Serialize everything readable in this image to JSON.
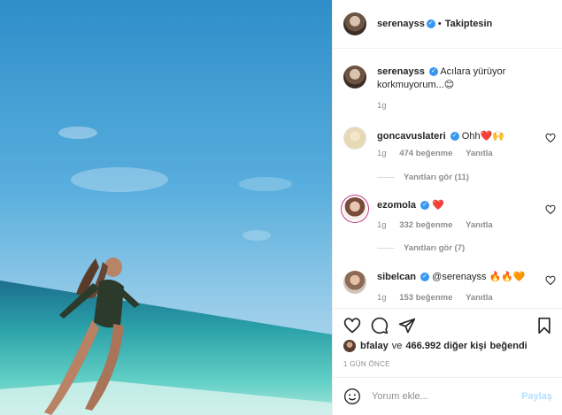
{
  "header": {
    "username": "serenayss",
    "separator": "•",
    "follow_label": "Takiptesin"
  },
  "caption": {
    "username": "serenayss",
    "text": "Acılara yürüyor korkmuyorum...😊",
    "time": "1g"
  },
  "comments": [
    {
      "username": "goncavuslateri",
      "text": "Ohh❤️🙌",
      "time": "1g",
      "likes": "474 beğenme",
      "reply_label": "Yanıtla",
      "view_replies": "Yanıtları gör (11)"
    },
    {
      "username": "ezomola",
      "text": "❤️",
      "time": "1g",
      "likes": "332 beğenme",
      "reply_label": "Yanıtla",
      "view_replies": "Yanıtları gör (7)"
    },
    {
      "username": "sibelcan",
      "text": "@serenayss 🔥🔥🧡",
      "time": "1g",
      "likes": "153 beğenme",
      "reply_label": "Yanıtla"
    }
  ],
  "likes": {
    "user": "bfalay",
    "connector": "ve",
    "count_text": "466.992 diğer kişi",
    "suffix": "beğendi"
  },
  "date_label": "1 GÜN ÖNCE",
  "comment_box": {
    "placeholder": "Yorum ekle...",
    "share_label": "Paylaş"
  },
  "icons": {
    "like": "heart-icon",
    "comment": "comment-icon",
    "share": "paper-plane-icon",
    "save": "bookmark-icon",
    "emoji": "emoji-icon",
    "verified": "verified-badge-icon"
  },
  "colors": {
    "verified": "#3897f0",
    "share_disabled": "#b2dffc",
    "muted_text": "#8e8e8e"
  }
}
